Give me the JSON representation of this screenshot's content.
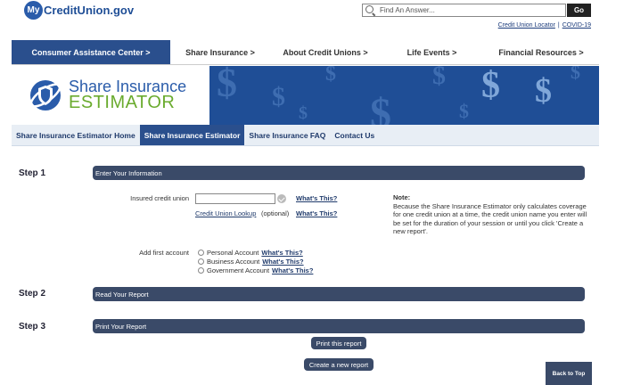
{
  "header": {
    "logo_my": "My",
    "logo_text": "CreditUnion.gov",
    "search_placeholder": "Find An Answer...",
    "go_label": "Go",
    "utility_links": [
      "Credit Union Locator",
      "COVID-19"
    ],
    "utility_sep": "|"
  },
  "mainnav": {
    "items": [
      {
        "label": "Consumer Assistance Center >"
      },
      {
        "label": "Share Insurance >"
      },
      {
        "label": "About Credit Unions >"
      },
      {
        "label": "Life Events >"
      },
      {
        "label": "Financial Resources >"
      }
    ]
  },
  "banner": {
    "title_line1": "Share Insurance",
    "title_line2": "ESTIMATOR",
    "accent_blue": "#1f4e96",
    "accent_green": "#6aab2e"
  },
  "subnav": {
    "tabs": [
      {
        "label": "Share Insurance Estimator Home"
      },
      {
        "label": "Share Insurance Estimator"
      },
      {
        "label": "Share Insurance FAQ"
      },
      {
        "label": "Contact Us"
      }
    ]
  },
  "steps": [
    {
      "label": "Step 1",
      "bar": "Enter Your Information"
    },
    {
      "label": "Step 2",
      "bar": "Read Your Report"
    },
    {
      "label": "Step 3",
      "bar": "Print Your Report"
    }
  ],
  "form": {
    "insured_label": "Insured credit union",
    "whats_this": "What's This?",
    "lookup_link": "Credit Union Lookup",
    "optional": "(optional)",
    "add_account_label": "Add first account",
    "accounts": [
      {
        "label": "Personal Account"
      },
      {
        "label": "Business Account"
      },
      {
        "label": "Government Account"
      }
    ]
  },
  "note": {
    "title": "Note:",
    "body": "Because the Share Insurance Estimator only calculates coverage for one credit union at a time, the credit union name you enter will be set for the duration of your session or until you click 'Create a new report'."
  },
  "buttons": {
    "print": "Print this report",
    "new_report": "Create a new report",
    "back_to_top": "Back to Top"
  }
}
